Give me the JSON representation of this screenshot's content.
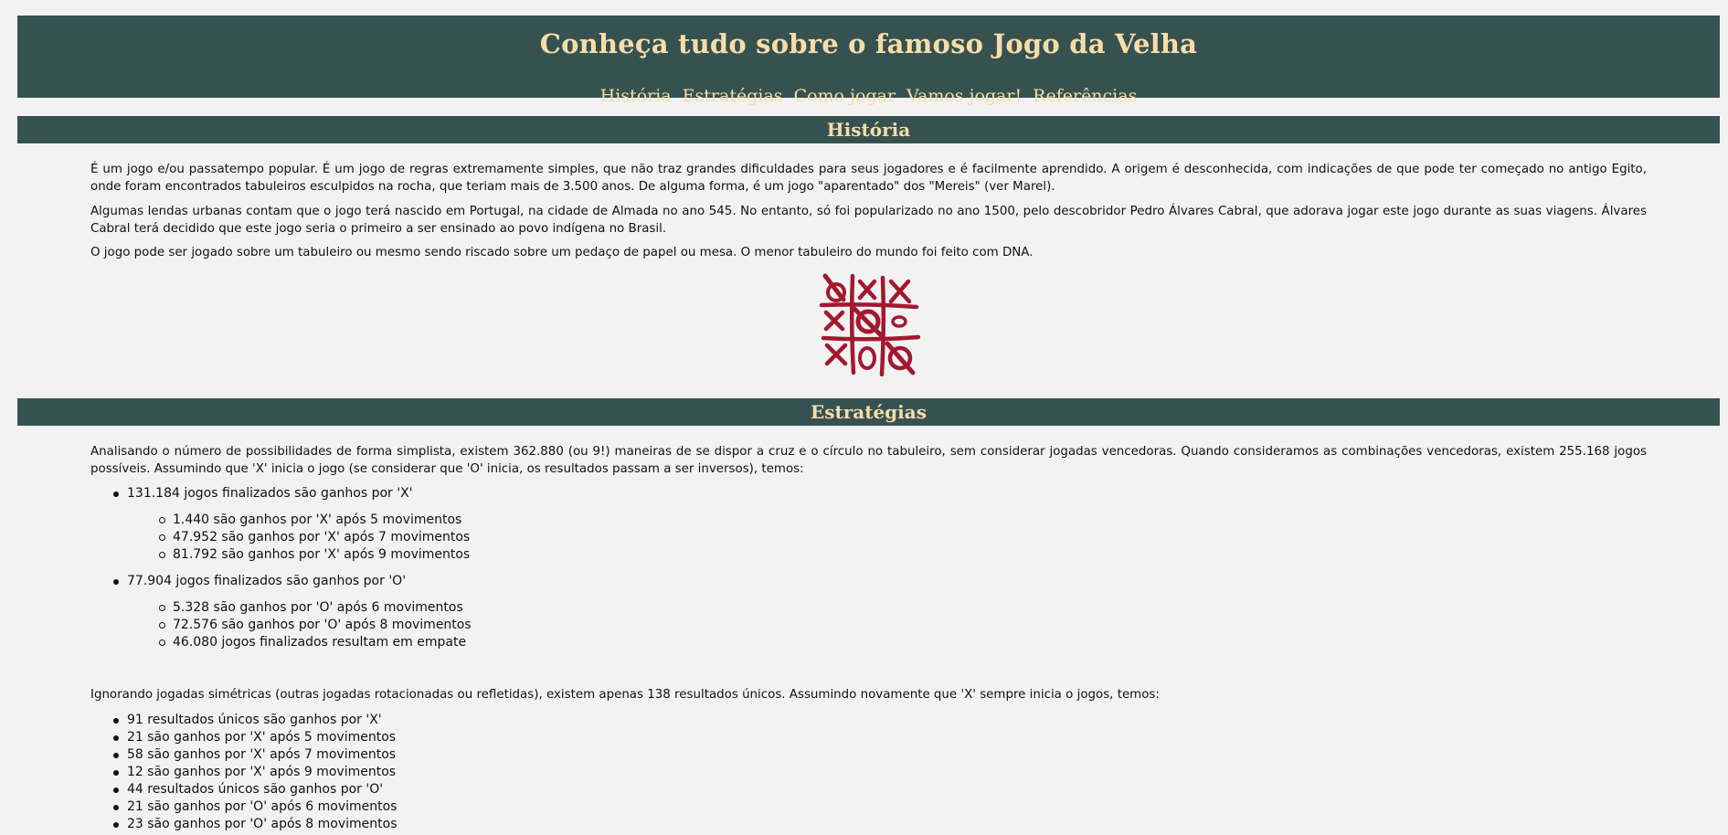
{
  "header": {
    "title": "Conheça tudo sobre o famoso Jogo da Velha",
    "nav": [
      "História",
      "Estratégias",
      "Como jogar",
      "Vamos jogar!",
      "Referências"
    ]
  },
  "historia": {
    "heading": "História",
    "paragraphs": [
      "É um jogo e/ou passatempo popular. É um jogo de regras extremamente simples, que não traz grandes dificuldades para seus jogadores e é facilmente aprendido. A origem é desconhecida, com indicações de que pode ter começado no antigo Egito, onde foram encontrados tabuleiros esculpidos na rocha, que teriam mais de 3.500 anos. De alguma forma, é um jogo \"aparentado\" dos \"Mereis\" (ver Marel).",
      "Algumas lendas urbanas contam que o jogo terá nascido em Portugal, na cidade de Almada no ano 545. No entanto, só foi popularizado no ano 1500, pelo descobridor Pedro Álvares Cabral, que adorava jogar este jogo durante as suas viagens. Álvares Cabral terá decidido que este jogo seria o primeiro a ser ensinado ao povo indígena no Brasil.",
      "O jogo pode ser jogado sobre um tabuleiro ou mesmo sendo riscado sobre um pedaço de papel ou mesa. O menor tabuleiro do mundo foi feito com DNA."
    ],
    "image": "tic-tac-toe-board-drawing"
  },
  "estrategias": {
    "heading": "Estratégias",
    "intro": "Analisando o número de possibilidades de forma simplista, existem 362.880 (ou 9!) maneiras de se dispor a cruz e o círculo no tabuleiro, sem considerar jogadas vencedoras. Quando consideramos as combinações vencedoras, existem 255.168 jogos possíveis. Assumindo que 'X' inicia o jogo (se considerar que 'O' inicia, os resultados passam a ser inversos), temos:",
    "x_total": "131.184 jogos finalizados são ganhos por 'X'",
    "x_sub": [
      "1.440 são ganhos por 'X' após 5 movimentos",
      "47.952 são ganhos por 'X' após 7 movimentos",
      "81.792 são ganhos por 'X' após 9 movimentos"
    ],
    "o_total": "77.904 jogos finalizados são ganhos por 'O'",
    "o_sub": [
      "5.328 são ganhos por 'O' após 6 movimentos",
      "72.576 são ganhos por 'O' após 8 movimentos",
      "46.080 jogos finalizados resultam em empate"
    ],
    "symmetric_intro": "Ignorando jogadas simétricas (outras jogadas rotacionadas ou refletidas), existem apenas 138 resultados únicos. Assumindo novamente que 'X' sempre inicia o jogos, temos:",
    "symmetric_list": [
      "91 resultados únicos são ganhos por 'X'",
      "21 são ganhos por 'X' após 5 movimentos",
      "58 são ganhos por 'X' após 7 movimentos",
      "12 são ganhos por 'X' após 9 movimentos",
      "44 resultados únicos são ganhos por 'O'",
      "21 são ganhos por 'O' após 6 movimentos",
      "23 são ganhos por 'O' após 8 movimentos"
    ]
  },
  "colors": {
    "bar": "#355251",
    "accent_text": "#f8dca7",
    "background": "#f3f2f2",
    "board_ink": "#a3182f"
  }
}
